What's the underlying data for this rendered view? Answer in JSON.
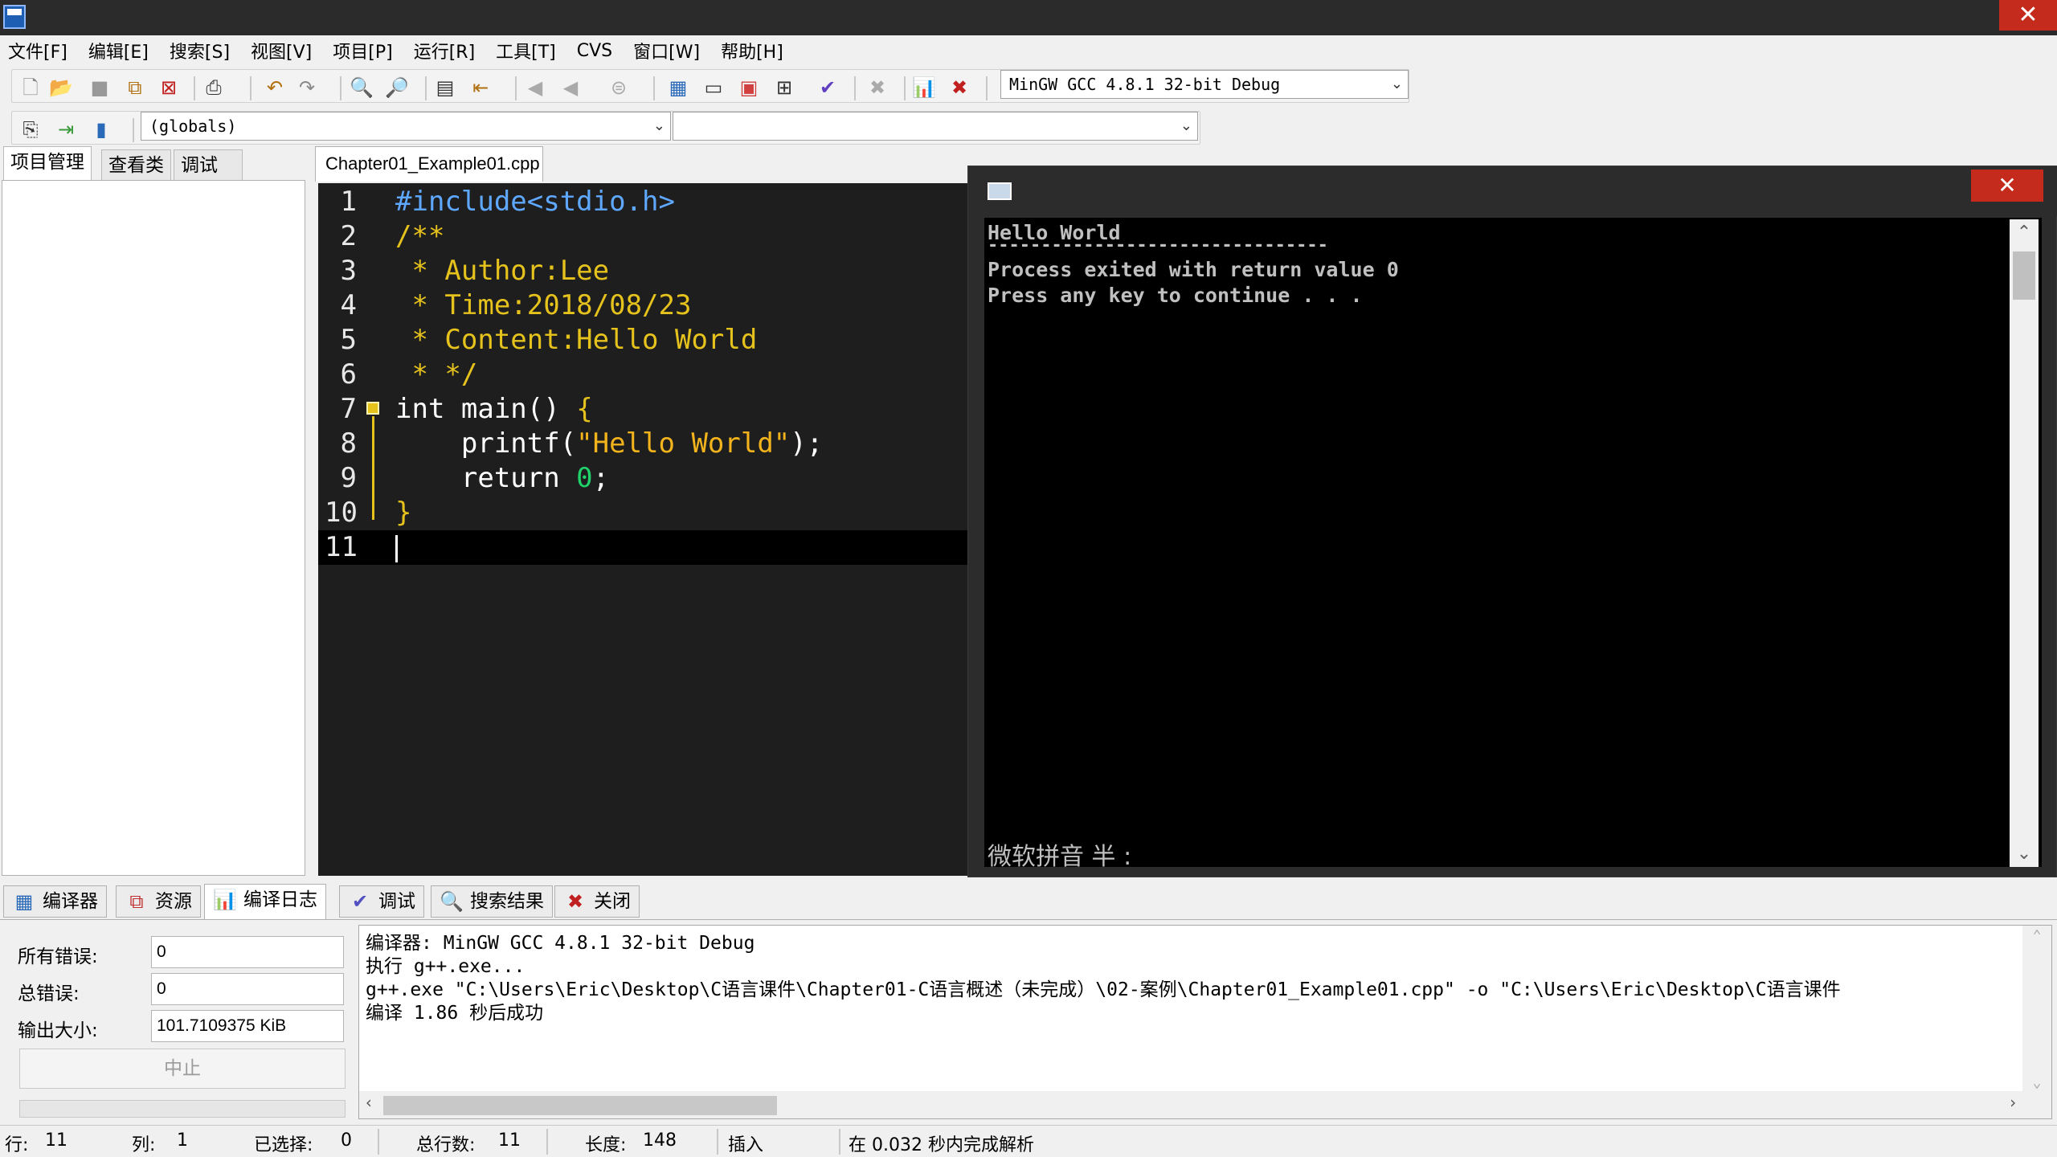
{
  "menu": [
    "文件[F]",
    "编辑[E]",
    "搜索[S]",
    "视图[V]",
    "项目[P]",
    "运行[R]",
    "工具[T]",
    "CVS",
    "窗口[W]",
    "帮助[H]"
  ],
  "toolbar": {
    "compiler_select": "MinGW GCC 4.8.1 32-bit Debug",
    "scope_select": "(globals)",
    "symbol_select": ""
  },
  "left_tabs": [
    "项目管理",
    "查看类",
    "调试"
  ],
  "editor": {
    "file_tab": "Chapter01_Example01.cpp",
    "lines": [
      {
        "n": "1",
        "segs": [
          {
            "t": "#include<stdio.h>",
            "c": "c-pre"
          }
        ]
      },
      {
        "n": "2",
        "segs": [
          {
            "t": "/**",
            "c": "c-com"
          }
        ]
      },
      {
        "n": "3",
        "segs": [
          {
            "t": " * Author:Lee",
            "c": "c-com"
          }
        ]
      },
      {
        "n": "4",
        "segs": [
          {
            "t": " * Time:2018/08/23",
            "c": "c-com"
          }
        ]
      },
      {
        "n": "5",
        "segs": [
          {
            "t": " * Content:Hello World",
            "c": "c-com"
          }
        ]
      },
      {
        "n": "6",
        "segs": [
          {
            "t": " * */",
            "c": "c-com"
          }
        ]
      },
      {
        "n": "7",
        "segs": [
          {
            "t": "int",
            "c": "c-kw"
          },
          {
            "t": " main() ",
            "c": "c-plain"
          },
          {
            "t": "{",
            "c": "c-com"
          }
        ]
      },
      {
        "n": "8",
        "segs": [
          {
            "t": "    printf(",
            "c": "c-plain"
          },
          {
            "t": "\"Hello World\"",
            "c": "c-str"
          },
          {
            "t": ");",
            "c": "c-plain"
          }
        ]
      },
      {
        "n": "9",
        "segs": [
          {
            "t": "    return ",
            "c": "c-plain"
          },
          {
            "t": "0",
            "c": "c-num"
          },
          {
            "t": ";",
            "c": "c-plain"
          }
        ]
      },
      {
        "n": "10",
        "segs": [
          {
            "t": "}",
            "c": "c-com"
          }
        ]
      },
      {
        "n": "11",
        "segs": []
      }
    ]
  },
  "console": {
    "lines": [
      "Hello World",
      "--------------------------------",
      "Process exited with return value 0",
      "Press any key to continue . . ."
    ],
    "ime_status": "微软拼音 半 :"
  },
  "bottom_tabs": [
    {
      "label": "编译器",
      "icon": "compiler-icon",
      "glyph": "▦",
      "color": "#2a6ab8"
    },
    {
      "label": "资源",
      "icon": "resources-icon",
      "glyph": "⧉",
      "color": "#c03030"
    },
    {
      "label": "编译日志",
      "icon": "compile-log-icon",
      "glyph": "📊",
      "color": "#1a5fb0"
    },
    {
      "label": "调试",
      "icon": "debug-icon",
      "glyph": "✔",
      "color": "#5050c0"
    },
    {
      "label": "搜索结果",
      "icon": "search-results-icon",
      "glyph": "🔍",
      "color": "#333"
    },
    {
      "label": "关闭",
      "icon": "close-icon",
      "glyph": "✖",
      "color": "#c02020"
    }
  ],
  "compile_stats": {
    "errors_label": "所有错误:",
    "errors_value": "0",
    "total_label": "总错误:",
    "total_value": "0",
    "size_label": "输出大小:",
    "size_value": "101.7109375 KiB",
    "abort_label": "中止"
  },
  "compile_log": [
    "编译器: MinGW GCC 4.8.1 32-bit Debug",
    "执行 g++.exe...",
    "g++.exe \"C:\\Users\\Eric\\Desktop\\C语言课件\\Chapter01-C语言概述（未完成）\\02-案例\\Chapter01_Example01.cpp\" -o \"C:\\Users\\Eric\\Desktop\\C语言课件",
    "编译 1.86 秒后成功"
  ],
  "status": {
    "row_label": "行:",
    "row_value": "11",
    "col_label": "列:",
    "col_value": "1",
    "sel_label": "已选择:",
    "sel_value": "0",
    "lines_label": "总行数:",
    "lines_value": "11",
    "len_label": "长度:",
    "len_value": "148",
    "mode": "插入",
    "parse_msg": "在 0.032 秒内完成解析"
  },
  "colors": {
    "titlebar": "#2b2b2b",
    "close_red": "#c42b1c",
    "editor_bg": "#1e1e1e",
    "console_bg": "#000000"
  }
}
